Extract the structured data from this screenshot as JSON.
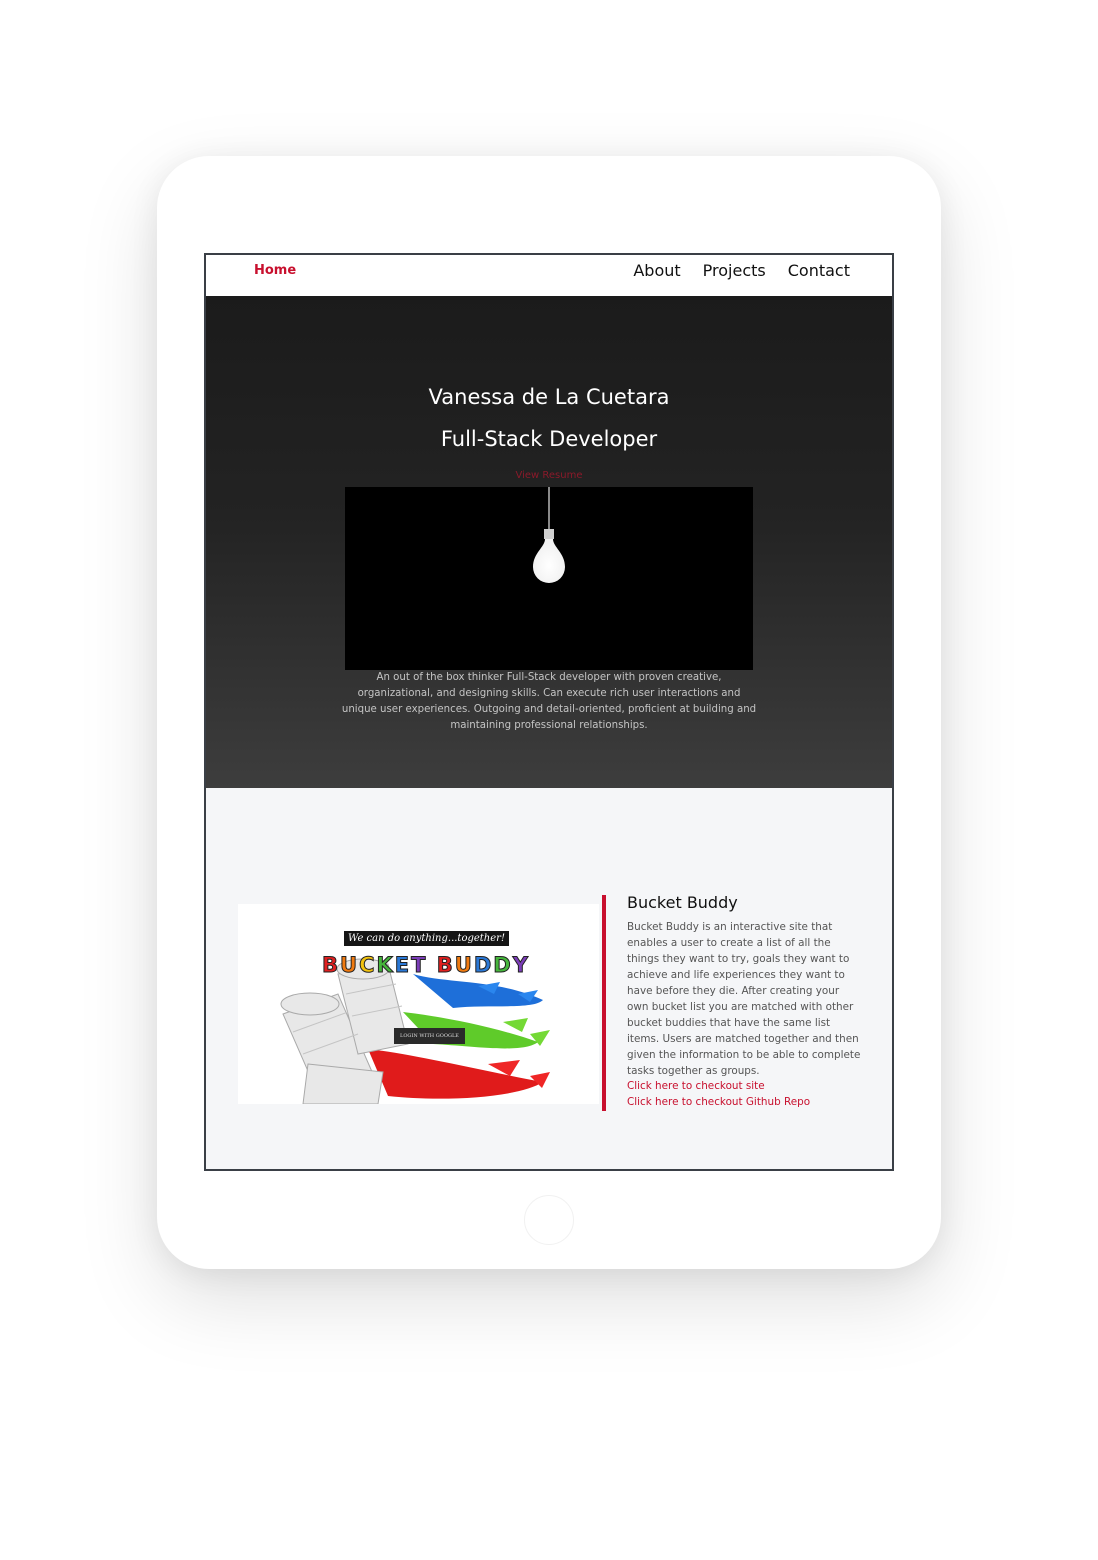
{
  "nav": {
    "brand": "Home",
    "links": [
      "About",
      "Projects",
      "Contact"
    ]
  },
  "hero": {
    "name": "Vanessa de La Cuetara",
    "title": "Full-Stack Developer",
    "resume_link": "View Resume",
    "about": "An out of the box thinker Full-Stack developer with proven creative, organizational, and designing skills. Can execute rich user interactions and unique user experiences. Outgoing and detail-oriented, proficient at building and maintaining professional relationships."
  },
  "project": {
    "image": {
      "tagline": "We can do anything...together!",
      "logo_text": "BUCKET BUDDY",
      "login_label": "LOGIN WITH GOOGLE"
    },
    "title": "Bucket Buddy",
    "description": "Bucket Buddy is an interactive site that enables a user to create a list of all the things they want to try, goals they want to achieve and life experiences they want to have before they die. After creating your own bucket list you are matched with other bucket buddies that have the same list items. Users are matched together and then given the information to be able to complete tasks together as groups.",
    "site_link": "Click here to checkout site",
    "repo_link": "Click here to checkout Github Repo"
  },
  "colors": {
    "accent": "#c8102e",
    "hero_top": "#1b1b1b",
    "hero_bottom": "#3d3d3d",
    "section_bg": "#f5f6f8"
  }
}
